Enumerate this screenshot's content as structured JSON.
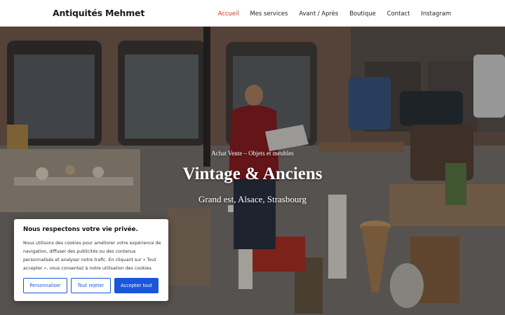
{
  "site": {
    "title": "Antiquités Mehmet"
  },
  "nav": {
    "items": [
      {
        "label": "Accueil",
        "active": true
      },
      {
        "label": "Mes services",
        "active": false
      },
      {
        "label": "Avant / Après",
        "active": false
      },
      {
        "label": "Boutique",
        "active": false
      },
      {
        "label": "Contact",
        "active": false
      },
      {
        "label": "Instagram",
        "active": false
      }
    ]
  },
  "hero": {
    "kicker": "Achat Vente – Objets et meubles",
    "title": "Vintage & Anciens",
    "subtitle": "Grand est, Alsace, Strasbourg"
  },
  "cookie": {
    "title": "Nous respectons votre vie privée.",
    "text": "Nous utilisons des cookies pour améliorer votre expérience de navigation, diffuser des publicités ou des contenus personnalisés et analyser notre trafic. En cliquant sur « Tout accepter », vous consentez à notre utilisation des cookies.",
    "customize_label": "Personnaliser",
    "reject_label": "Tout rejeter",
    "accept_label": "Accepter tout"
  },
  "colors": {
    "accent": "#c0392b",
    "button_blue": "#1a56db",
    "header_bg": "#ffffff"
  }
}
